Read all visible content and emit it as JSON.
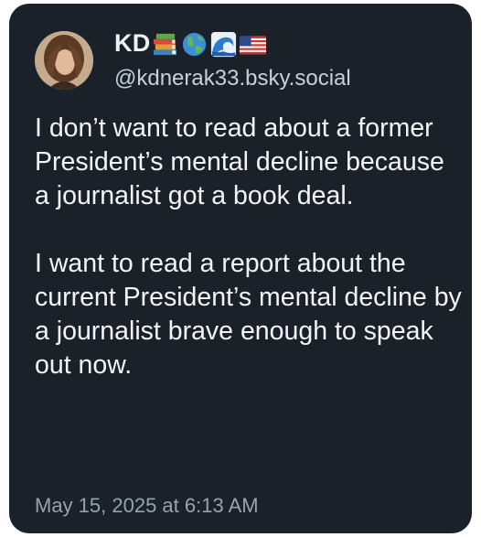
{
  "post": {
    "display_name": "KD",
    "name_emojis": [
      "books-emoji",
      "globe-emoji",
      "wave-emoji",
      "us-flag-emoji"
    ],
    "handle": "@kdnerak33.bsky.social",
    "paragraphs": [
      "I don’t want to read about a former President’s mental decline because a journalist got a book deal.",
      "I want to read a report about the current President’s mental decline by a journalist brave enough to speak out now."
    ],
    "timestamp": "May 15, 2025 at 6:13 AM"
  },
  "colors": {
    "card_background": "#1a2129",
    "text_primary": "#f2f4f6",
    "text_secondary": "#98a3af"
  }
}
